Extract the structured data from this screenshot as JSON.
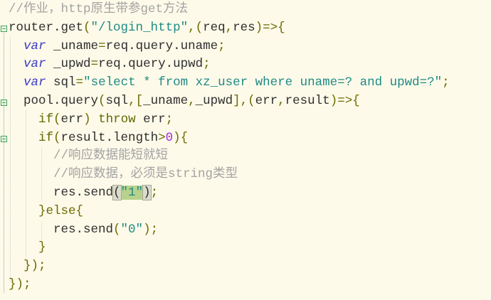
{
  "editor": {
    "lines": [
      [
        [
          "//作业，http原生带参get方法",
          "cm"
        ]
      ],
      [
        [
          "router.get",
          ""
        ],
        [
          "(",
          "p"
        ],
        [
          "\"/login_http\"",
          "str"
        ],
        [
          ",",
          "p"
        ],
        [
          "(",
          "p"
        ],
        [
          "req",
          ""
        ],
        [
          ",",
          "p"
        ],
        [
          "res",
          ""
        ],
        [
          ")=>{",
          "p"
        ]
      ],
      [
        [
          "  ",
          ""
        ],
        [
          "var",
          "kw"
        ],
        [
          " _uname",
          ""
        ],
        [
          "=",
          "p"
        ],
        [
          "req.query.uname",
          ""
        ],
        [
          ";",
          "p"
        ]
      ],
      [
        [
          "  ",
          ""
        ],
        [
          "var",
          "kw"
        ],
        [
          " _upwd",
          ""
        ],
        [
          "=",
          "p"
        ],
        [
          "req.query.upwd",
          ""
        ],
        [
          ";",
          "p"
        ]
      ],
      [
        [
          "  ",
          ""
        ],
        [
          "var",
          "kw"
        ],
        [
          " sql",
          ""
        ],
        [
          "=",
          "p"
        ],
        [
          "\"select * from xz_user where uname=? and upwd=?\"",
          "str"
        ],
        [
          ";",
          "p"
        ]
      ],
      [
        [
          "  pool.query",
          ""
        ],
        [
          "(",
          "p"
        ],
        [
          "sql",
          ""
        ],
        [
          ",[",
          "p"
        ],
        [
          "_uname",
          ""
        ],
        [
          ",",
          "p"
        ],
        [
          "_upwd",
          ""
        ],
        [
          "],(",
          "p"
        ],
        [
          "err",
          ""
        ],
        [
          ",",
          "p"
        ],
        [
          "result",
          ""
        ],
        [
          ")=>{",
          "p"
        ]
      ],
      [
        [
          "    ",
          ""
        ],
        [
          "if",
          "ctl"
        ],
        [
          "(",
          "p"
        ],
        [
          "err",
          ""
        ],
        [
          ")",
          "p"
        ],
        [
          " throw",
          "ctl"
        ],
        [
          " err",
          ""
        ],
        [
          ";",
          "p"
        ]
      ],
      [
        [
          "    ",
          ""
        ],
        [
          "if",
          "ctl"
        ],
        [
          "(",
          "p"
        ],
        [
          "result.length",
          ""
        ],
        [
          ">",
          "p"
        ],
        [
          "0",
          "num"
        ],
        [
          "){",
          "p"
        ]
      ],
      [
        [
          "      ",
          ""
        ],
        [
          "//响应数据能短就短",
          "cm"
        ]
      ],
      [
        [
          "      ",
          ""
        ],
        [
          "//响应数据，必须是string类型",
          "cm"
        ]
      ],
      [
        [
          "      res.send",
          ""
        ],
        [
          "(",
          "br"
        ],
        [
          "\"1\"",
          "hl"
        ],
        [
          "|",
          "caret"
        ],
        [
          ")",
          "br"
        ],
        [
          ";",
          "p"
        ]
      ],
      [
        [
          "    ",
          ""
        ],
        [
          "}else{",
          "p"
        ]
      ],
      [
        [
          "      res.send",
          ""
        ],
        [
          "(",
          "p"
        ],
        [
          "\"0\"",
          "str"
        ],
        [
          ")",
          "p"
        ],
        [
          ";",
          "p"
        ]
      ],
      [
        [
          "    ",
          ""
        ],
        [
          "}",
          "p"
        ]
      ],
      [
        [
          "  ",
          ""
        ],
        [
          "});",
          "p"
        ]
      ],
      [
        [
          "});",
          "p"
        ]
      ]
    ]
  },
  "colors": {
    "background": "#fefae9",
    "string": "#1f8a86",
    "keyword": "#3b3bc4",
    "comment": "#a3a3a3",
    "number": "#a626e6"
  }
}
